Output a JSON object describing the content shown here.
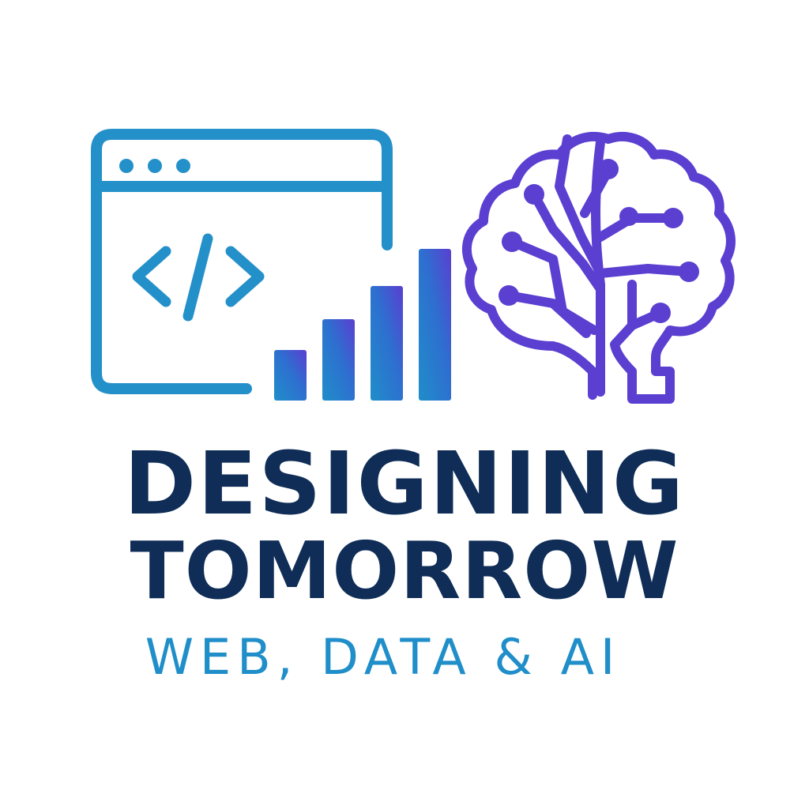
{
  "logo": {
    "title_line1": "DESIGNING",
    "title_line2": "TOMORROW",
    "subtitle": "WEB, DATA & AI",
    "code_symbol": "</>"
  },
  "icons": {
    "browser": "browser-window-icon",
    "code": "code-brackets-icon",
    "chart": "bar-chart-icon",
    "brain": "circuit-brain-icon"
  },
  "colors": {
    "title": "#0f2d57",
    "subtitle": "#1f8ec9",
    "browser_stroke": "#2490c9",
    "bars_start": "#1f8ec9",
    "bars_end": "#5a3fd0",
    "brain_stroke": "#5b3fd1",
    "background": "#ffffff"
  }
}
